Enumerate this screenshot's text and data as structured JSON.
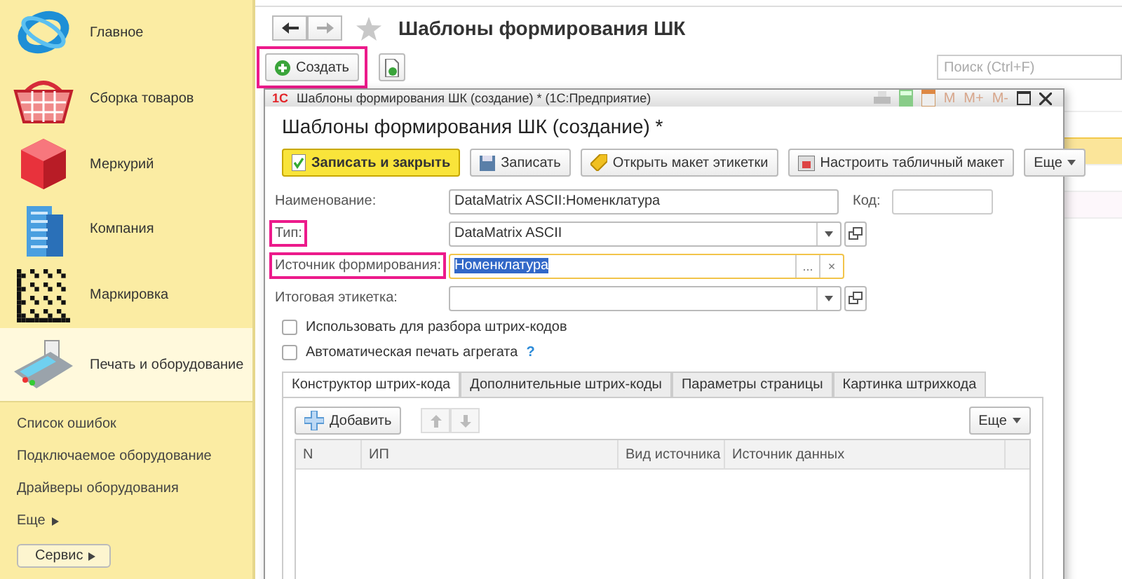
{
  "sidebar": {
    "sections": [
      {
        "label": "Главное",
        "selected": false
      },
      {
        "label": "Сборка товаров",
        "selected": false
      },
      {
        "label": "Меркурий",
        "selected": false
      },
      {
        "label": "Компания",
        "selected": false
      },
      {
        "label": "Маркировка",
        "selected": false
      },
      {
        "label": "Печать и оборудование",
        "selected": true
      }
    ],
    "links": [
      {
        "label": "Список ошибок",
        "kind": "link"
      },
      {
        "label": "Подключаемое оборудование",
        "kind": "link"
      },
      {
        "label": "Драйверы оборудования",
        "kind": "link"
      },
      {
        "label": "Еще",
        "kind": "more"
      }
    ],
    "service_button": "Сервис"
  },
  "page": {
    "title": "Шаблоны формирования ШК",
    "create_button": {
      "label": "Создать",
      "highlighted": true
    },
    "search": {
      "placeholder": "Поиск (Ctrl+F)"
    },
    "list_rows": [
      {
        "selected": false
      },
      {
        "selected": true
      },
      {
        "selected": false
      },
      {
        "selected": false
      },
      {
        "selected": false
      }
    ]
  },
  "dialog": {
    "window_title": "Шаблоны формирования ШК (создание) *  (1С:Предприятие)",
    "logo": "1С",
    "memory_buttons": [
      "M",
      "M+",
      "M-"
    ],
    "heading": "Шаблоны формирования ШК (создание) *",
    "actions": [
      {
        "label": "Записать и закрыть",
        "kind": "primary"
      },
      {
        "label": "Записать",
        "kind": "save"
      },
      {
        "label": "Открыть макет этикетки",
        "kind": "label"
      },
      {
        "label": "Настроить табличный макет",
        "kind": "table"
      },
      {
        "label": "Еще",
        "kind": "menu"
      }
    ],
    "fields": [
      {
        "label": "Наименование:",
        "value": "DataMatrix ASCII:Номенклатура",
        "kind": "text",
        "highlighted": false,
        "focused": false
      },
      {
        "label": "Тип:",
        "value": "DataMatrix ASCII",
        "kind": "select",
        "highlighted": true,
        "focused": false
      },
      {
        "label": "Источник формирования:",
        "value": "Номенклатура",
        "kind": "choice",
        "highlighted": true,
        "focused": true,
        "buttons": [
          "...",
          "×"
        ]
      },
      {
        "label": "Итоговая этикетка:",
        "kind": "select",
        "highlighted": false,
        "focused": false
      }
    ],
    "code_field": {
      "label": "Код:"
    },
    "checkboxes": [
      {
        "label": "Использовать для разбора штрих-кодов",
        "checked": false
      },
      {
        "label": "Автоматическая печать агрегата",
        "checked": false,
        "help": "?"
      }
    ],
    "tabs": [
      {
        "label": "Конструктор штрих-кода",
        "selected": true
      },
      {
        "label": "Дополнительные штрих-коды",
        "selected": false
      },
      {
        "label": "Параметры страницы",
        "selected": false
      },
      {
        "label": "Картинка штрихкода",
        "selected": false
      }
    ],
    "panel": {
      "add_button": "Добавить",
      "more_button": "Еще",
      "columns": [
        "N",
        "ИП",
        "Вид источника",
        "Источник данных"
      ]
    }
  }
}
